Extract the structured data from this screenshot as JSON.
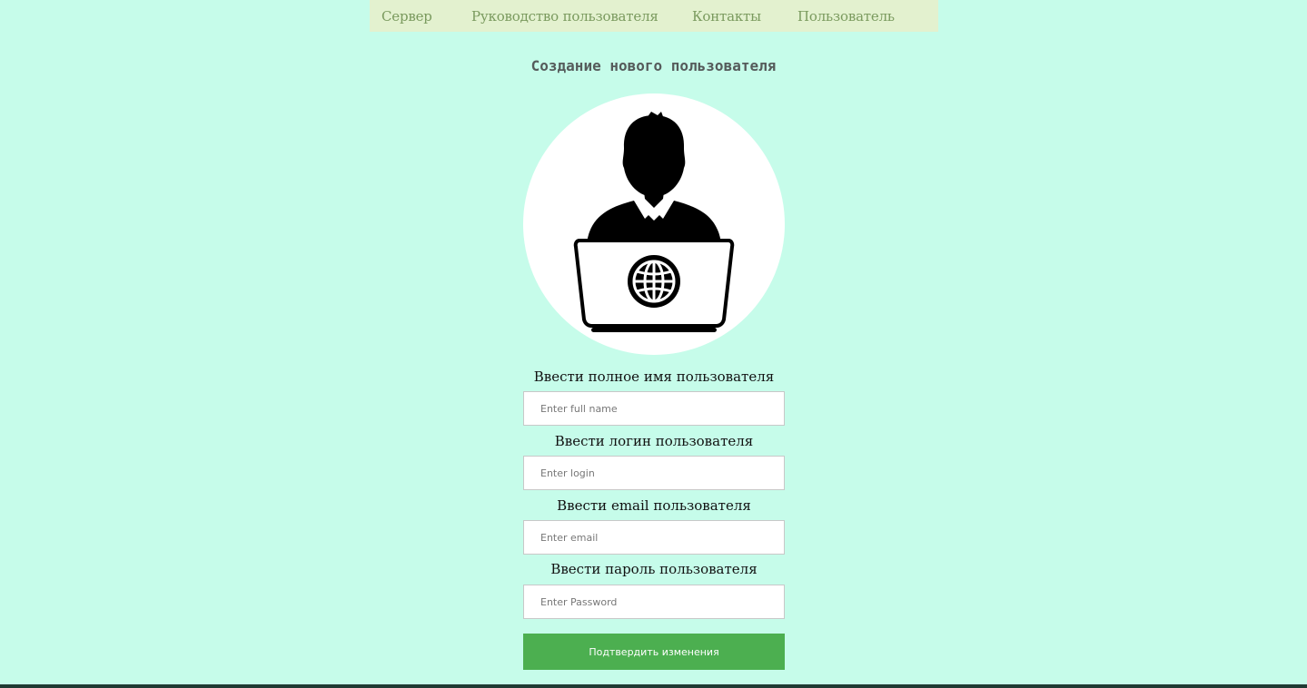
{
  "nav": {
    "items": [
      {
        "label": "Сервер"
      },
      {
        "label": "Руководство пользователя"
      },
      {
        "label": "Контакты"
      },
      {
        "label": "Пользователь"
      }
    ]
  },
  "page_title": "Создание нового пользователя",
  "avatar": {
    "icon": "user-laptop-globe-icon"
  },
  "form": {
    "fields": [
      {
        "label": "Ввести полное имя пользователя",
        "placeholder": "Enter full name",
        "value": ""
      },
      {
        "label": "Ввести логин пользователя",
        "placeholder": "Enter login",
        "value": ""
      },
      {
        "label": "Ввести email пользователя",
        "placeholder": "Enter email",
        "value": ""
      },
      {
        "label": "Ввести пароль пользователя",
        "placeholder": "Enter Password",
        "value": ""
      }
    ],
    "submit_label": "Подтвердить изменения"
  },
  "colors": {
    "background": "#c6fcea",
    "navbar": "#e3f1cf",
    "nav_text": "#7a9a5e",
    "submit_button": "#4caf50"
  }
}
